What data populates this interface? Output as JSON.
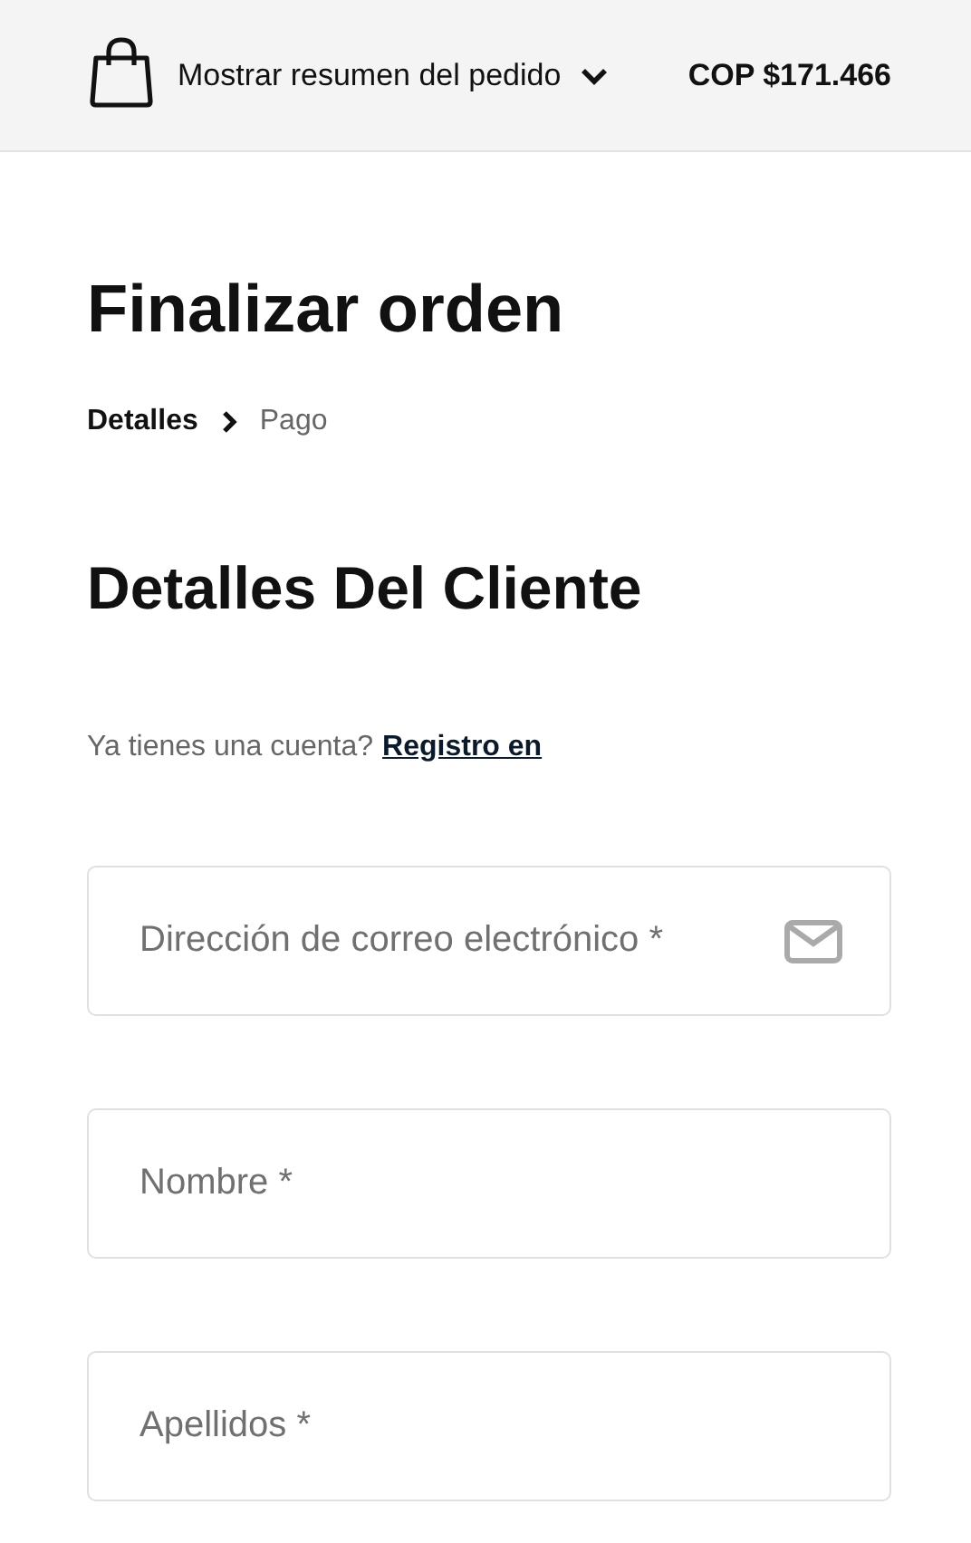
{
  "header": {
    "summary_toggle": "Mostrar resumen del pedido",
    "expanded": false,
    "total": "COP $171.466"
  },
  "title": "Finalizar orden",
  "breadcrumb": [
    {
      "label": "Detalles",
      "selected": true
    },
    {
      "label": "Pago",
      "selected": false
    }
  ],
  "section_title": "Detalles Del Cliente",
  "login_prompt": {
    "text": "Ya tienes una cuenta?",
    "link": "Registro en"
  },
  "fields": [
    {
      "placeholder": "Dirección de correo electrónico *",
      "kind": "email"
    },
    {
      "placeholder": "Nombre *"
    },
    {
      "placeholder": "Apellidos *"
    }
  ]
}
